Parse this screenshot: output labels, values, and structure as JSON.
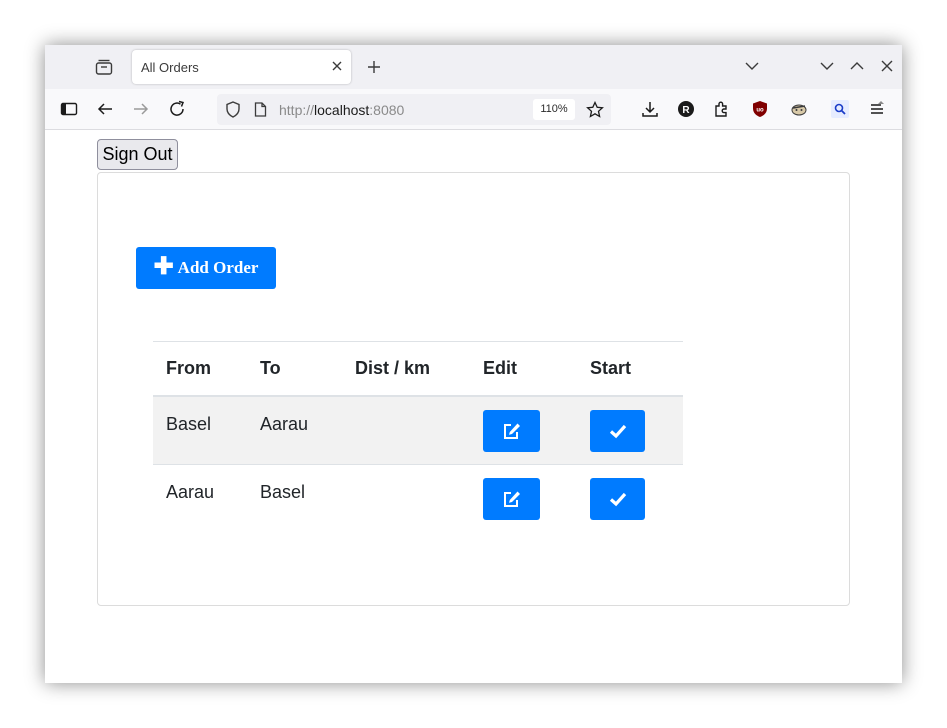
{
  "browser": {
    "tab_title": "All Orders",
    "url_scheme": "http://",
    "url_host": "localhost",
    "url_port": ":8080",
    "zoom": "110%"
  },
  "page": {
    "signout_label": "Sign Out",
    "add_order_label": "Add Order",
    "columns": {
      "from": "From",
      "to": "To",
      "dist": "Dist / km",
      "edit": "Edit",
      "start": "Start"
    },
    "rows": [
      {
        "from": "Basel",
        "to": "Aarau",
        "dist": ""
      },
      {
        "from": "Aarau",
        "to": "Basel",
        "dist": ""
      }
    ]
  },
  "colors": {
    "accent": "#007bff",
    "stripe": "#f2f2f2"
  },
  "icons": [
    "tab-overview-icon",
    "close-icon",
    "plus-icon",
    "chevron-down-icon",
    "chevron-up-icon",
    "sidebar-icon",
    "back-icon",
    "forward-icon",
    "reload-icon",
    "shield-icon",
    "page-icon",
    "star-icon",
    "download-icon",
    "extension-icon",
    "edit-icon",
    "check-icon"
  ]
}
